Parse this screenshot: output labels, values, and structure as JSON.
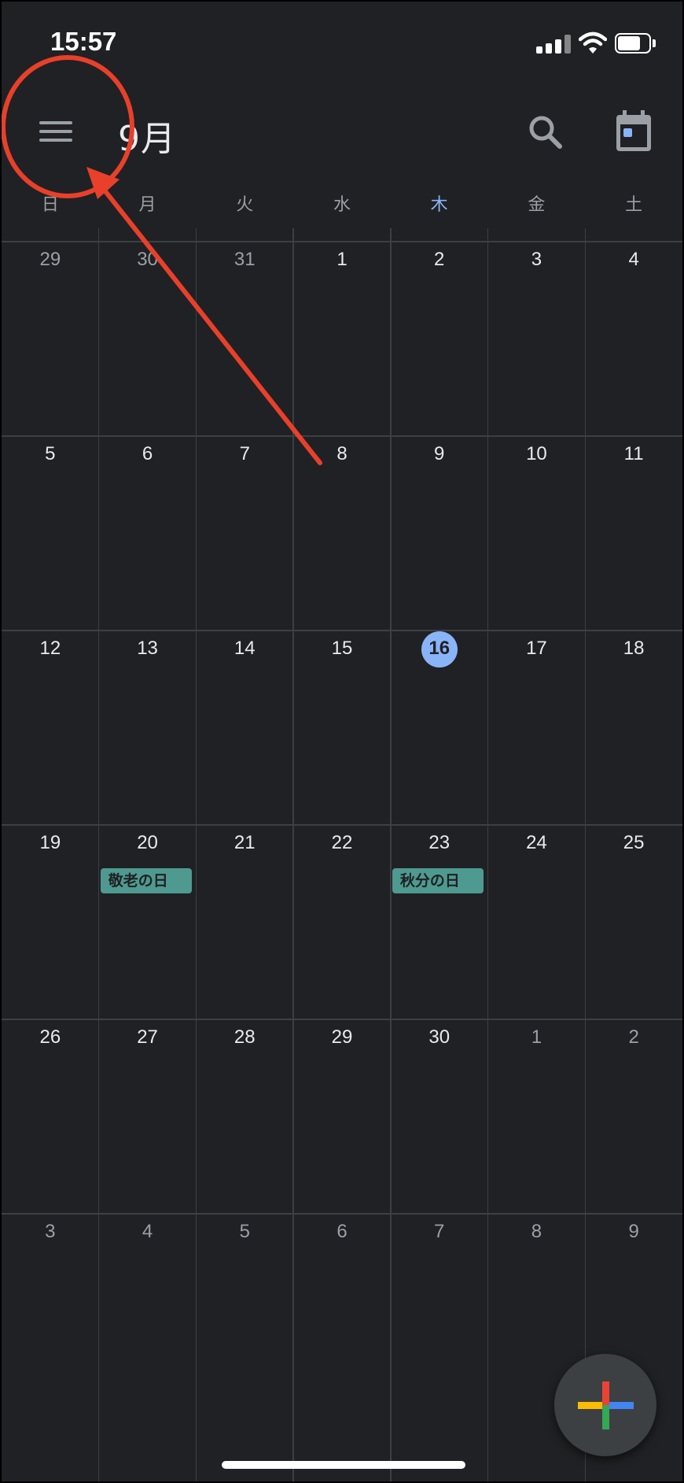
{
  "status_bar": {
    "time": "15:57"
  },
  "app_bar": {
    "month_title": "9月",
    "menu_icon": "hamburger-menu-icon",
    "search_icon": "search-icon",
    "today_icon": "calendar-today-icon"
  },
  "weekdays": [
    "日",
    "月",
    "火",
    "水",
    "木",
    "金",
    "土"
  ],
  "today_weekday_index": 4,
  "weeks": [
    [
      {
        "d": "29",
        "muted": true
      },
      {
        "d": "30",
        "muted": true
      },
      {
        "d": "31",
        "muted": true
      },
      {
        "d": "1"
      },
      {
        "d": "2"
      },
      {
        "d": "3"
      },
      {
        "d": "4"
      }
    ],
    [
      {
        "d": "5"
      },
      {
        "d": "6"
      },
      {
        "d": "7"
      },
      {
        "d": "8"
      },
      {
        "d": "9"
      },
      {
        "d": "10"
      },
      {
        "d": "11"
      }
    ],
    [
      {
        "d": "12"
      },
      {
        "d": "13"
      },
      {
        "d": "14"
      },
      {
        "d": "15"
      },
      {
        "d": "16",
        "today": true
      },
      {
        "d": "17"
      },
      {
        "d": "18"
      }
    ],
    [
      {
        "d": "19"
      },
      {
        "d": "20",
        "event": "敬老の日"
      },
      {
        "d": "21"
      },
      {
        "d": "22"
      },
      {
        "d": "23",
        "event": "秋分の日"
      },
      {
        "d": "24"
      },
      {
        "d": "25"
      }
    ],
    [
      {
        "d": "26"
      },
      {
        "d": "27"
      },
      {
        "d": "28"
      },
      {
        "d": "29"
      },
      {
        "d": "30"
      },
      {
        "d": "1",
        "muted": true
      },
      {
        "d": "2",
        "muted": true
      }
    ],
    [
      {
        "d": "3",
        "muted": true
      },
      {
        "d": "4",
        "muted": true
      },
      {
        "d": "5",
        "muted": true
      },
      {
        "d": "6",
        "muted": true
      },
      {
        "d": "7",
        "muted": true
      },
      {
        "d": "8",
        "muted": true
      },
      {
        "d": "9",
        "muted": true
      }
    ]
  ],
  "colors": {
    "background": "#202124",
    "today": "#8ab4f8",
    "holiday_chip": "#4e9a90",
    "annotation": "#e8402a"
  },
  "fab": {
    "icon": "add-plus-icon"
  }
}
